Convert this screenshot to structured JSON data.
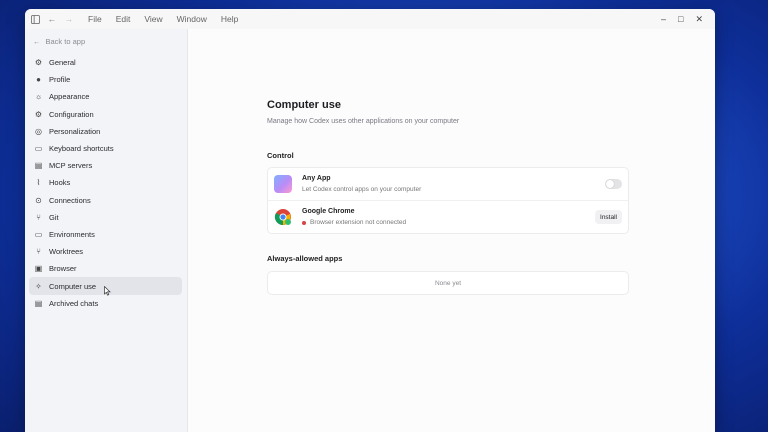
{
  "titlebar": {
    "menu": [
      "File",
      "Edit",
      "View",
      "Window",
      "Help"
    ]
  },
  "sidebar": {
    "back_label": "Back to app",
    "items": [
      {
        "label": "General",
        "icon": "gear-icon"
      },
      {
        "label": "Profile",
        "icon": "user-icon"
      },
      {
        "label": "Appearance",
        "icon": "sun-icon"
      },
      {
        "label": "Configuration",
        "icon": "settings-icon"
      },
      {
        "label": "Personalization",
        "icon": "sliders-icon"
      },
      {
        "label": "Keyboard shortcuts",
        "icon": "keyboard-icon"
      },
      {
        "label": "MCP servers",
        "icon": "server-icon"
      },
      {
        "label": "Hooks",
        "icon": "hook-icon"
      },
      {
        "label": "Connections",
        "icon": "link-icon"
      },
      {
        "label": "Git",
        "icon": "branch-icon"
      },
      {
        "label": "Environments",
        "icon": "monitor-icon"
      },
      {
        "label": "Worktrees",
        "icon": "tree-icon"
      },
      {
        "label": "Browser",
        "icon": "browser-icon"
      },
      {
        "label": "Computer use",
        "icon": "cursor-sparkle-icon"
      },
      {
        "label": "Archived chats",
        "icon": "archive-icon"
      }
    ],
    "active": "Computer use"
  },
  "main": {
    "title": "Computer use",
    "subtitle": "Manage how Codex uses other applications on your computer",
    "control": {
      "heading": "Control",
      "rows": [
        {
          "title": "Any App",
          "desc": "Let Codex control apps on your computer",
          "toggle_on": false
        },
        {
          "title": "Google Chrome",
          "desc": "Browser extension not connected",
          "status_color": "#d64545",
          "button": "Install"
        }
      ]
    },
    "always_allowed": {
      "heading": "Always-allowed apps",
      "empty": "None yet"
    }
  }
}
